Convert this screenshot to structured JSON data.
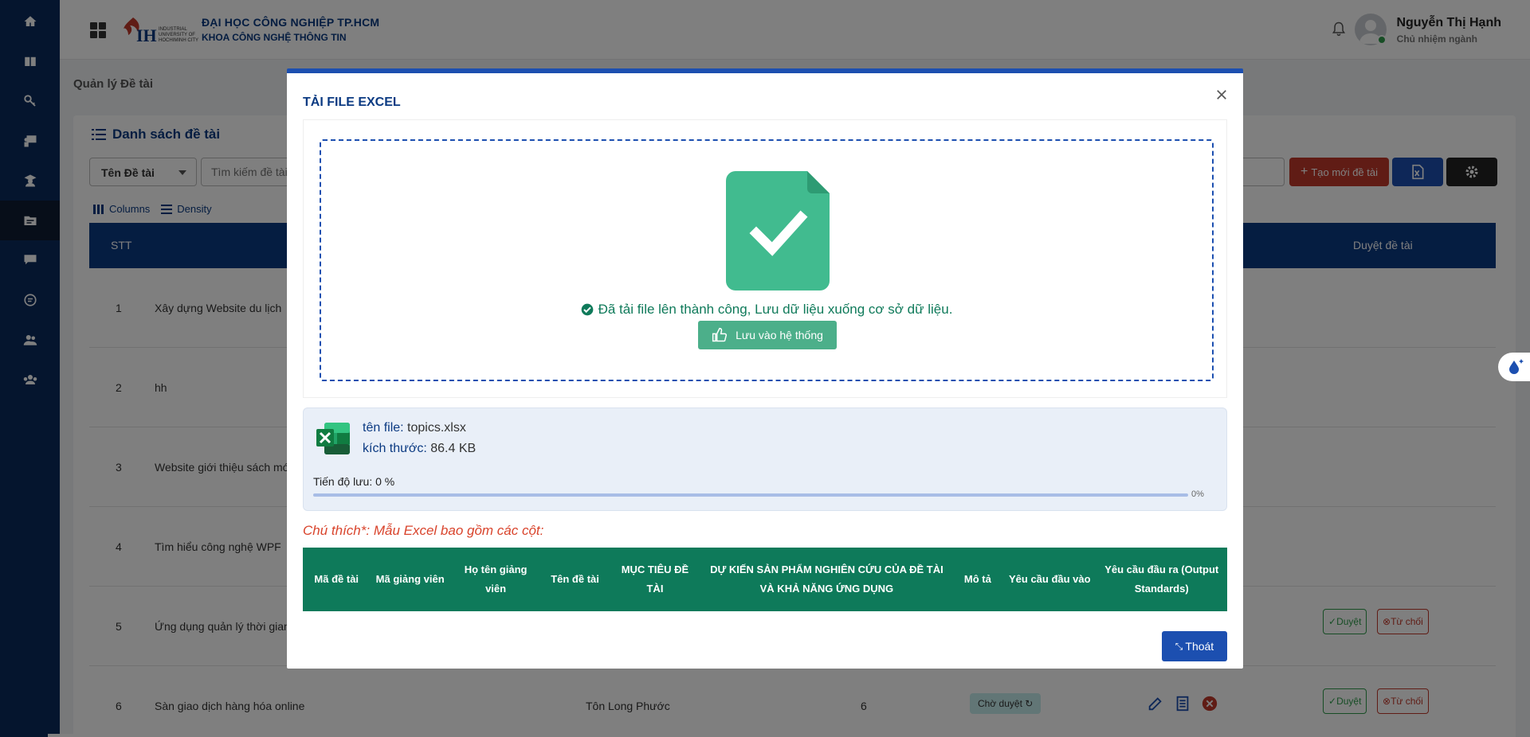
{
  "header": {
    "university": "ĐẠI HỌC CÔNG NGHIỆP TP.HCM",
    "department": "KHOA CÔNG NGHỆ THÔNG TIN",
    "user_name": "Nguyễn Thị Hạnh",
    "user_role": "Chủ nhiệm ngành"
  },
  "page": {
    "title": "Quản lý Đề tài",
    "list_title": "Danh sách đề tài",
    "search_field_select": "Tên Đề tài",
    "search_placeholder": "Tìm kiếm đề tài",
    "create_button": "Tạo mới đề tài",
    "columns_label": "Columns",
    "density_label": "Density",
    "table_headers": {
      "stt": "STT",
      "approve": "Duyệt đề tài"
    },
    "rows": [
      {
        "stt": "1",
        "name": "Xây dựng Website du lịch"
      },
      {
        "stt": "2",
        "name": "hh"
      },
      {
        "stt": "3",
        "name": "Website giới thiệu sách mới"
      },
      {
        "stt": "4",
        "name": "Tìm hiểu công nghệ WPF"
      },
      {
        "stt": "5",
        "name": "Ứng dụng quản lý thời gian"
      },
      {
        "stt": "6",
        "name": "Sàn giao dịch hàng hóa online",
        "lecturer": "Tôn Long Phước",
        "quantity": "6",
        "status": "Chờ duyệt"
      }
    ],
    "approve_label": "Duyệt",
    "reject_label": "Từ chối"
  },
  "modal": {
    "title": "TẢI FILE EXCEL",
    "success_message": "Đã tải file lên thành công, Lưu dữ liệu xuống cơ sở dữ liệu.",
    "save_button": "Lưu vào hệ thống",
    "file_name_label": "tên file:",
    "file_name": "topics.xlsx",
    "file_size_label": "kích thước:",
    "file_size": "86.4 KB",
    "progress_text": "Tiến độ lưu: 0 %",
    "progress_value": 0,
    "progress_pct": "0%",
    "note": "Chú thích*: Mẫu Excel bao gồm các cột:",
    "sample_columns": [
      "Mã đề tài",
      "Mã giảng viên",
      "Họ tên giảng viên",
      "Tên đề tài",
      "MỤC TIÊU ĐỀ TÀI",
      "DỰ KIẾN SẢN PHẨM NGHIÊN CỨU CỦA ĐỀ TÀI VÀ KHẢ NĂNG ỨNG DỤNG",
      "Mô tả",
      "Yêu cầu đầu vào",
      "Yêu cầu đầu ra (Output Standards)"
    ],
    "exit_button": "Thoát"
  },
  "colors": {
    "sidebar": "#0b2a5c",
    "primary": "#1c4fb0",
    "table_green": "#0e7a5a",
    "success": "#4caf8a",
    "danger": "#c0392b"
  },
  "icons": {
    "sidebar": [
      "home-icon",
      "book-icon",
      "key-icon",
      "chalkboard-icon",
      "student-icon",
      "folder-icon",
      "chat-icon",
      "comment-icon",
      "users-icon",
      "group-icon"
    ]
  }
}
